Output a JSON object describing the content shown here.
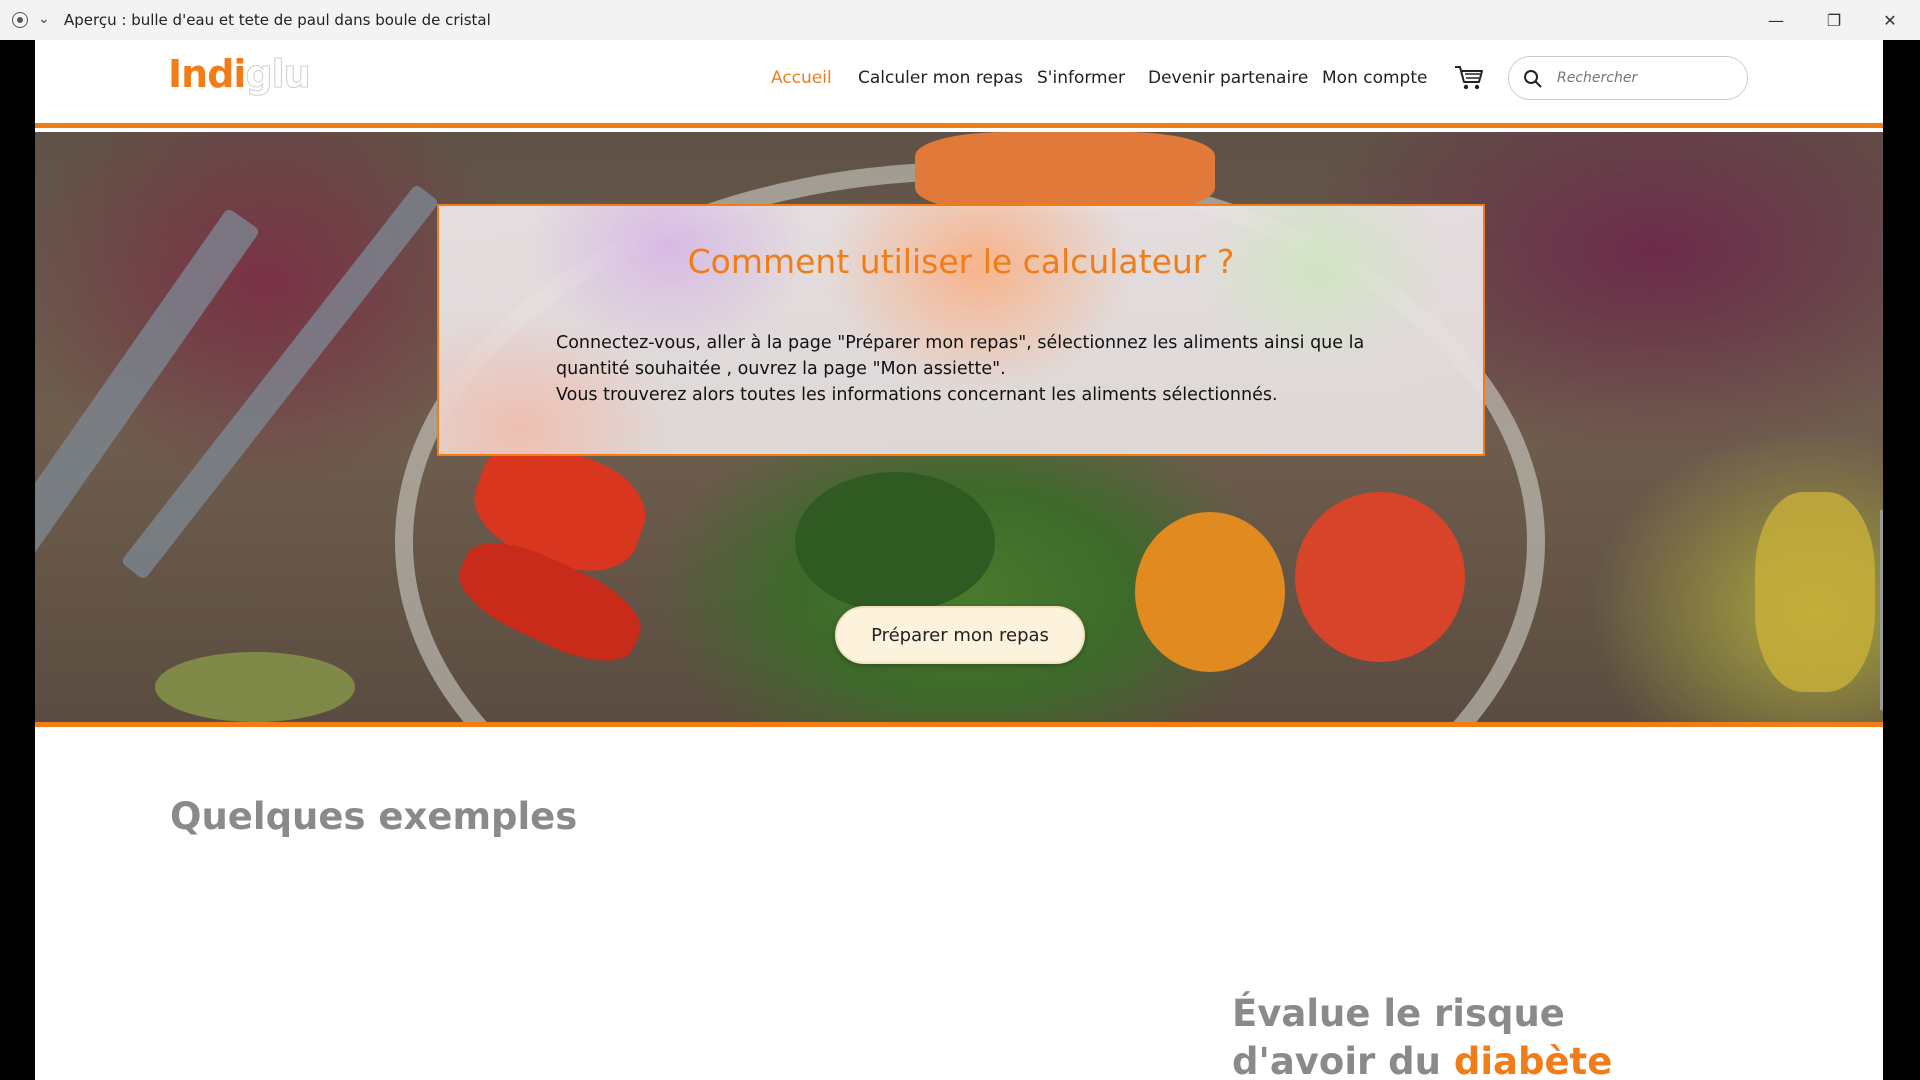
{
  "window": {
    "title": "Aperçu : bulle d'eau et tete de paul dans boule de cristal",
    "controls": {
      "minimize": "—",
      "restore": "❐",
      "close": "✕"
    }
  },
  "header": {
    "logo": {
      "part1": "Indi",
      "part2": "glu"
    },
    "nav": [
      {
        "label": "Accueil",
        "active": true
      },
      {
        "label": "Calculer mon repas",
        "active": false
      },
      {
        "label": "S'informer",
        "active": false
      },
      {
        "label": "Devenir partenaire",
        "active": false
      },
      {
        "label": "Mon compte",
        "active": false
      }
    ],
    "cart_icon": "cart-icon",
    "search": {
      "placeholder": "Rechercher",
      "icon": "search-icon"
    }
  },
  "hero": {
    "title": "Comment utiliser le calculateur ?",
    "text_line1": "Connectez-vous, aller à la page \"Préparer mon repas\", sélectionnez les aliments ainsi que la quantité souhaitée , ouvrez la page \"Mon assiette\".",
    "text_line2": "Vous trouverez alors toutes les informations concernant les aliments sélectionnés.",
    "button": "Préparer mon repas"
  },
  "examples": {
    "title": "Quelques exemples",
    "risk_line1": "Évalue le risque",
    "risk_line2_prefix": "d'avoir du ",
    "risk_line2_highlight": "diabète"
  },
  "colors": {
    "accent": "#f07d17",
    "heading_gray": "#8a8a8a"
  }
}
